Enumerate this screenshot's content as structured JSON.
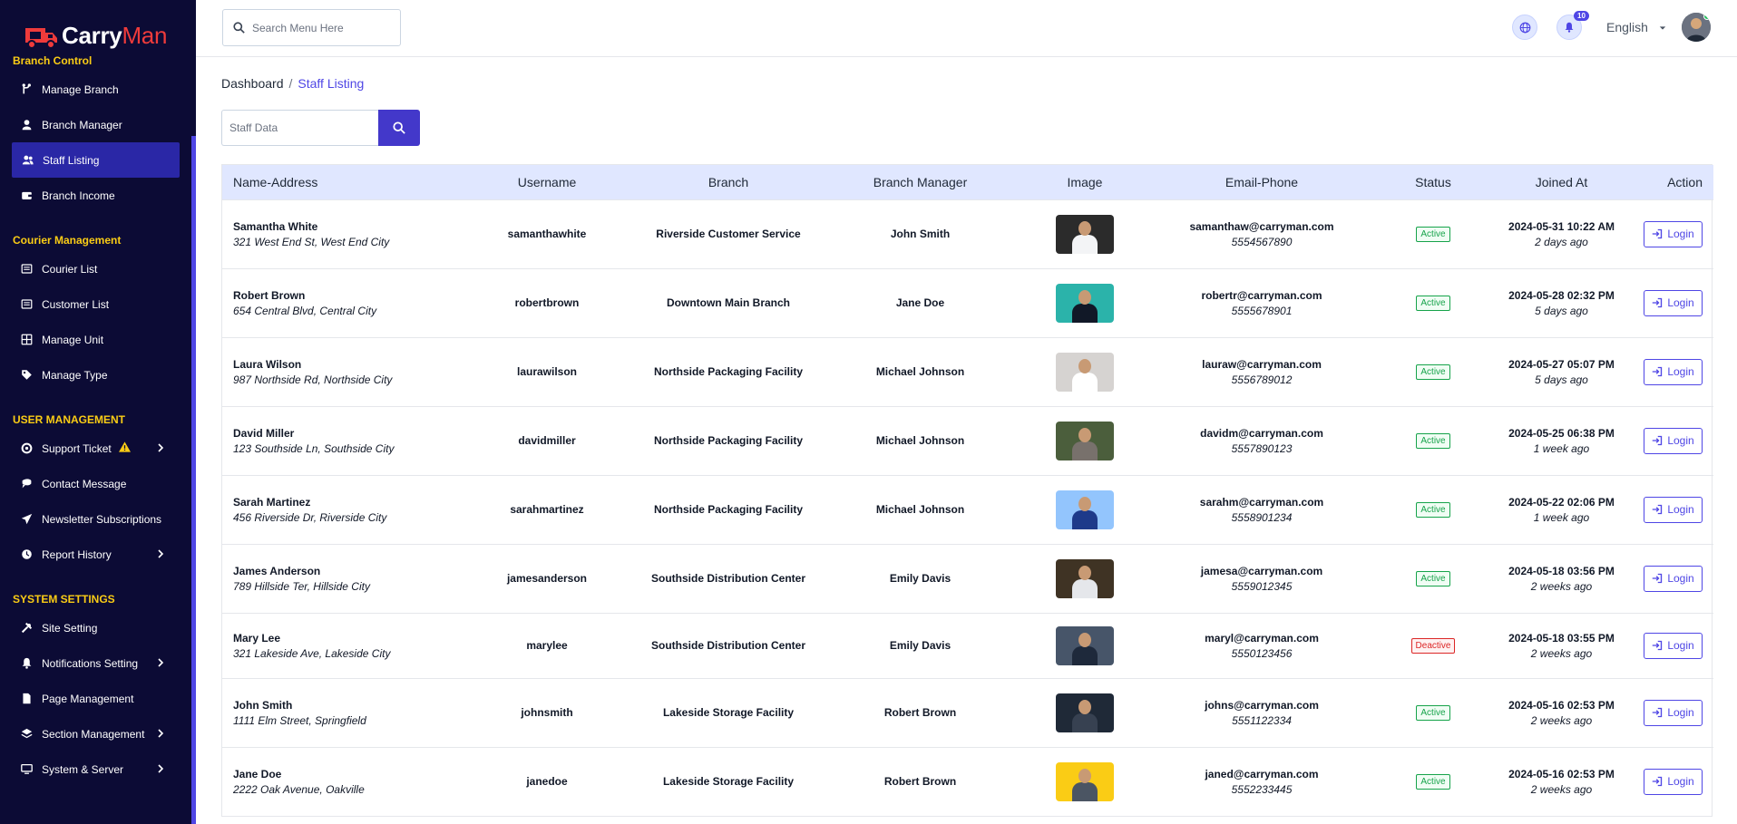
{
  "app": {
    "brand_carry": "Carry",
    "brand_man": "Man"
  },
  "colors": {
    "sidebar_bg": "#0c0b35",
    "accent": "#4f46e5",
    "section_title": "#facc15",
    "active_item_bg": "#2a27a6",
    "brand_red": "#ef3b3b"
  },
  "sidebar": {
    "sections": [
      {
        "title": "Branch Control",
        "items": [
          {
            "label": "Manage Branch",
            "icon": "branch-icon"
          },
          {
            "label": "Branch Manager",
            "icon": "user-icon"
          },
          {
            "label": "Staff Listing",
            "icon": "users-icon",
            "active": true
          },
          {
            "label": "Branch Income",
            "icon": "wallet-icon"
          }
        ]
      },
      {
        "title": "Courier Management",
        "items": [
          {
            "label": "Courier List",
            "icon": "list-icon"
          },
          {
            "label": "Customer List",
            "icon": "list-icon"
          },
          {
            "label": "Manage Unit",
            "icon": "grid-icon"
          },
          {
            "label": "Manage Type",
            "icon": "tag-icon"
          }
        ]
      },
      {
        "title": "USER MANAGEMENT",
        "items": [
          {
            "label": "Support Ticket",
            "icon": "lifebuoy-icon",
            "warn": true,
            "chevron": true
          },
          {
            "label": "Contact Message",
            "icon": "message-icon"
          },
          {
            "label": "Newsletter Subscriptions",
            "icon": "send-icon"
          },
          {
            "label": "Report History",
            "icon": "clock-icon",
            "chevron": true
          }
        ]
      },
      {
        "title": "SYSTEM SETTINGS",
        "items": [
          {
            "label": "Site Setting",
            "icon": "tools-icon"
          },
          {
            "label": "Notifications Setting",
            "icon": "bell-icon",
            "chevron": true
          },
          {
            "label": "Page Management",
            "icon": "file-icon"
          },
          {
            "label": "Section Management",
            "icon": "layers-icon",
            "chevron": true
          },
          {
            "label": "System & Server",
            "icon": "monitor-icon",
            "chevron": true
          }
        ]
      }
    ]
  },
  "topbar": {
    "search_placeholder": "Search Menu Here",
    "notification_count": "10",
    "language": "English"
  },
  "breadcrumb": {
    "home": "Dashboard",
    "separator": "/",
    "current": "Staff Listing"
  },
  "filter": {
    "placeholder": "Staff Data"
  },
  "table": {
    "columns": [
      "Name-Address",
      "Username",
      "Branch",
      "Branch Manager",
      "Image",
      "Email-Phone",
      "Status",
      "Joined At",
      "Action"
    ],
    "action_label": "Login",
    "rows": [
      {
        "name": "Samantha White",
        "address": "321 West End St, West End City",
        "username": "samanthawhite",
        "branch": "Riverside Customer Service",
        "manager": "John Smith",
        "email": "samanthaw@carryman.com",
        "phone": "5554567890",
        "status": "Active",
        "joined": "2024-05-31 10:22 AM",
        "ago": "2 days ago",
        "photo_bg": "#2b2b2b",
        "shirt": "#f3f4f6"
      },
      {
        "name": "Robert Brown",
        "address": "654 Central Blvd, Central City",
        "username": "robertbrown",
        "branch": "Downtown Main Branch",
        "manager": "Jane Doe",
        "email": "robertr@carryman.com",
        "phone": "5555678901",
        "status": "Active",
        "joined": "2024-05-28 02:32 PM",
        "ago": "5 days ago",
        "photo_bg": "#2bb3aa",
        "shirt": "#111827"
      },
      {
        "name": "Laura Wilson",
        "address": "987 Northside Rd, Northside City",
        "username": "laurawilson",
        "branch": "Northside Packaging Facility",
        "manager": "Michael Johnson",
        "email": "lauraw@carryman.com",
        "phone": "5556789012",
        "status": "Active",
        "joined": "2024-05-27 05:07 PM",
        "ago": "5 days ago",
        "photo_bg": "#d6d3d1",
        "shirt": "#ffffff"
      },
      {
        "name": "David Miller",
        "address": "123 Southside Ln, Southside City",
        "username": "davidmiller",
        "branch": "Northside Packaging Facility",
        "manager": "Michael Johnson",
        "email": "davidm@carryman.com",
        "phone": "5557890123",
        "status": "Active",
        "joined": "2024-05-25 06:38 PM",
        "ago": "1 week ago",
        "photo_bg": "#4b5e3c",
        "shirt": "#78716c"
      },
      {
        "name": "Sarah Martinez",
        "address": "456 Riverside Dr, Riverside City",
        "username": "sarahmartinez",
        "branch": "Northside Packaging Facility",
        "manager": "Michael Johnson",
        "email": "sarahm@carryman.com",
        "phone": "5558901234",
        "status": "Active",
        "joined": "2024-05-22 02:06 PM",
        "ago": "1 week ago",
        "photo_bg": "#93c5fd",
        "shirt": "#1e3a8a"
      },
      {
        "name": "James Anderson",
        "address": "789 Hillside Ter, Hillside City",
        "username": "jamesanderson",
        "branch": "Southside Distribution Center",
        "manager": "Emily Davis",
        "email": "jamesa@carryman.com",
        "phone": "5559012345",
        "status": "Active",
        "joined": "2024-05-18 03:56 PM",
        "ago": "2 weeks ago",
        "photo_bg": "#3f3324",
        "shirt": "#e5e7eb"
      },
      {
        "name": "Mary Lee",
        "address": "321 Lakeside Ave, Lakeside City",
        "username": "marylee",
        "branch": "Southside Distribution Center",
        "manager": "Emily Davis",
        "email": "maryl@carryman.com",
        "phone": "5550123456",
        "status": "Deactive",
        "joined": "2024-05-18 03:55 PM",
        "ago": "2 weeks ago",
        "photo_bg": "#475569",
        "shirt": "#1e293b"
      },
      {
        "name": "John Smith",
        "address": "1111 Elm Street, Springfield",
        "username": "johnsmith",
        "branch": "Lakeside Storage Facility",
        "manager": "Robert Brown",
        "email": "johns@carryman.com",
        "phone": "5551122334",
        "status": "Active",
        "joined": "2024-05-16 02:53 PM",
        "ago": "2 weeks ago",
        "photo_bg": "#1f2937",
        "shirt": "#374151"
      },
      {
        "name": "Jane Doe",
        "address": "2222 Oak Avenue, Oakville",
        "username": "janedoe",
        "branch": "Lakeside Storage Facility",
        "manager": "Robert Brown",
        "email": "janed@carryman.com",
        "phone": "5552233445",
        "status": "Active",
        "joined": "2024-05-16 02:53 PM",
        "ago": "2 weeks ago",
        "photo_bg": "#facc15",
        "shirt": "#4b5563"
      }
    ]
  }
}
